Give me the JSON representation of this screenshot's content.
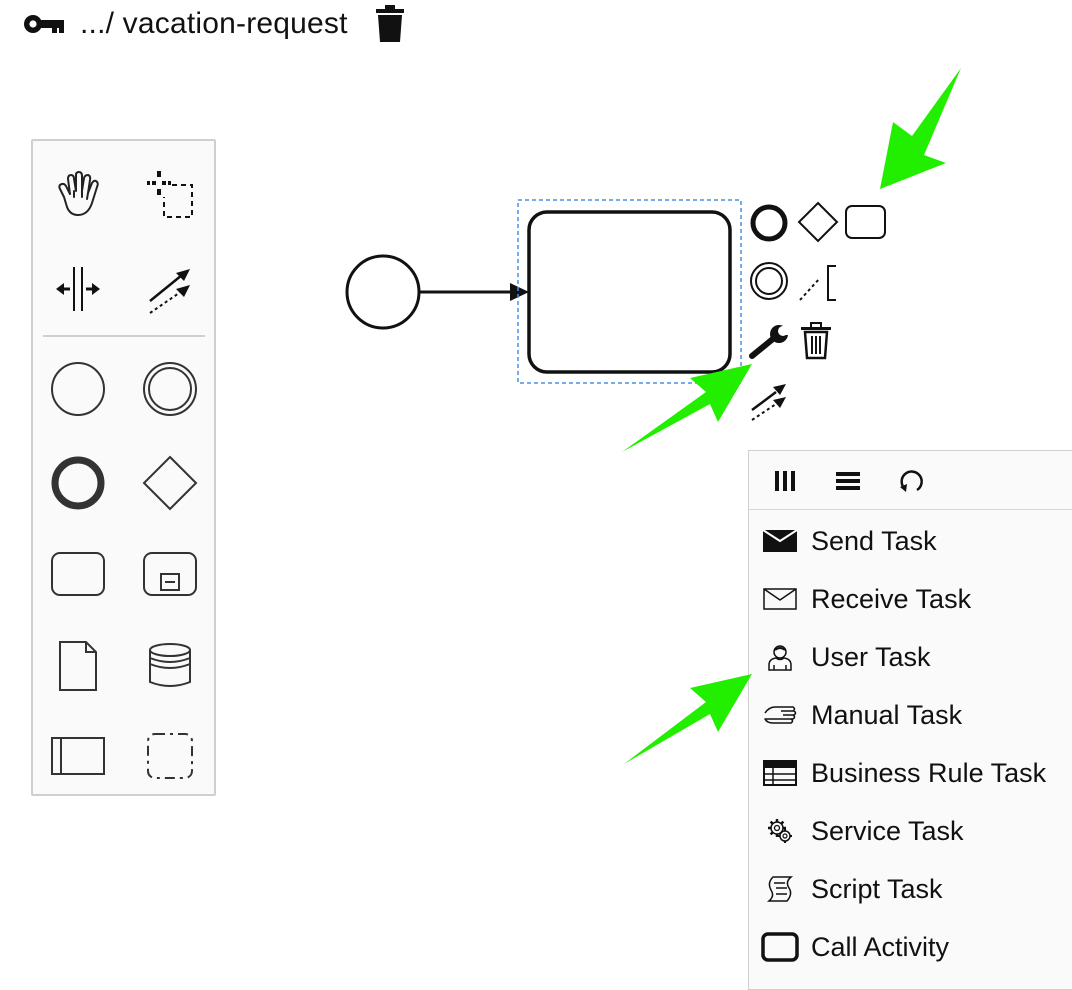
{
  "header": {
    "key_icon": "key-icon",
    "title": ".../ vacation-request",
    "delete_icon": "trash-icon"
  },
  "palette": {
    "tools": [
      {
        "name": "hand-tool",
        "icon": "hand-icon"
      },
      {
        "name": "lasso-tool",
        "icon": "lasso-icon"
      },
      {
        "name": "space-tool",
        "icon": "space-icon"
      },
      {
        "name": "global-connect-tool",
        "icon": "connect-icon"
      },
      {
        "name": "create-start-event",
        "icon": "start-event-icon"
      },
      {
        "name": "create-intermediate-event",
        "icon": "intermediate-event-icon"
      },
      {
        "name": "create-end-event",
        "icon": "end-event-icon"
      },
      {
        "name": "create-gateway",
        "icon": "gateway-icon"
      },
      {
        "name": "create-task",
        "icon": "task-icon"
      },
      {
        "name": "create-subprocess",
        "icon": "subprocess-icon"
      },
      {
        "name": "create-data-object",
        "icon": "data-object-icon"
      },
      {
        "name": "create-data-store",
        "icon": "data-store-icon"
      },
      {
        "name": "create-pool",
        "icon": "pool-icon"
      },
      {
        "name": "create-group",
        "icon": "group-icon"
      }
    ]
  },
  "context_pad": {
    "items": [
      "end-event-icon",
      "gateway-icon",
      "task-icon",
      "intermediate-event-icon",
      "text-annotation-icon",
      "wrench-icon",
      "trash-icon",
      "connect-icon"
    ]
  },
  "replace_menu": {
    "header_icons": [
      "parallel-multi-instance-icon",
      "sequential-multi-instance-icon",
      "loop-icon"
    ],
    "items": [
      {
        "label": "Send Task",
        "icon": "send-envelope-icon"
      },
      {
        "label": "Receive Task",
        "icon": "receive-envelope-icon"
      },
      {
        "label": "User Task",
        "icon": "user-icon"
      },
      {
        "label": "Manual Task",
        "icon": "manual-hand-icon"
      },
      {
        "label": "Business Rule Task",
        "icon": "business-rule-icon"
      },
      {
        "label": "Service Task",
        "icon": "gear-icon"
      },
      {
        "label": "Script Task",
        "icon": "script-icon"
      },
      {
        "label": "Call Activity",
        "icon": "call-activity-icon"
      }
    ]
  },
  "colors": {
    "annotation_arrow": "#22ee00",
    "selection_outline": "#4a90e2",
    "stroke": "#111111"
  }
}
